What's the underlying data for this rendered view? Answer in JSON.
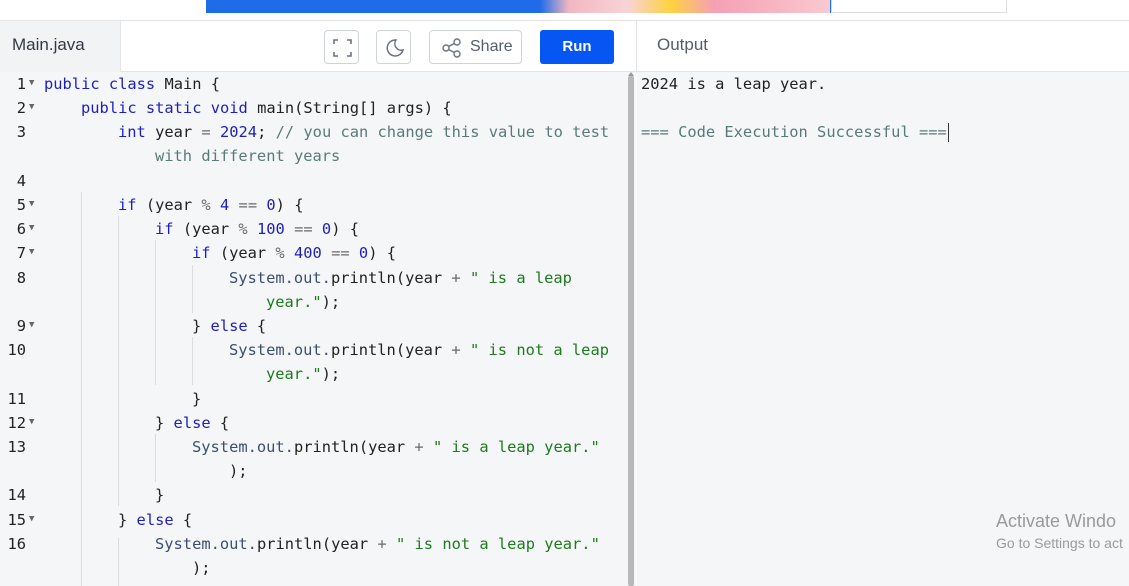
{
  "header": {
    "file_tab": "Main.java",
    "share_label": "Share",
    "run_label": "Run",
    "output_title": "Output"
  },
  "editor": {
    "line_numbers": [
      "1",
      "2",
      "3",
      "4",
      "5",
      "6",
      "7",
      "8",
      "9",
      "10",
      "11",
      "12",
      "13",
      "14",
      "15",
      "16"
    ],
    "code": {
      "l1a": "public class",
      "l1b": " Main {",
      "l2a": "public static void",
      "l2b": " main(String[] args) {",
      "l3a": "int",
      "l3b": " year ",
      "l3c": "=",
      "l3d": " ",
      "l3e": "2024",
      "l3f": "; ",
      "l3g": "// you can change this value to test",
      "l3h": "with different years",
      "l5a": "if",
      "l5b": " (year ",
      "l5c": "%",
      "l5d": " ",
      "l5e": "4",
      "l5f": " ",
      "l5g": "==",
      "l5h": " ",
      "l5i": "0",
      "l5j": ") {",
      "l6a": "if",
      "l6b": " (year ",
      "l6c": "%",
      "l6d": " ",
      "l6e": "100",
      "l6f": " ",
      "l6g": "==",
      "l6h": " ",
      "l6i": "0",
      "l6j": ") {",
      "l7a": "if",
      "l7b": " (year ",
      "l7c": "%",
      "l7d": " ",
      "l7e": "400",
      "l7f": " ",
      "l7g": "==",
      "l7h": " ",
      "l7i": "0",
      "l7j": ") {",
      "l8a": "System",
      "l8b": ".out.",
      "l8c": "println(year ",
      "l8d": "+",
      "l8e": " ",
      "l8f": "\" is a leap",
      "l8g": "year.\"",
      "l8h": ");",
      "l9a": "} ",
      "l9b": "else",
      "l9c": " {",
      "l10a": "System",
      "l10b": ".out.",
      "l10c": "println(year ",
      "l10d": "+",
      "l10e": " ",
      "l10f": "\" is not a leap",
      "l10g": "year.\"",
      "l10h": ");",
      "l11": "}",
      "l12a": "} ",
      "l12b": "else",
      "l12c": " {",
      "l13a": "System",
      "l13b": ".out.",
      "l13c": "println(year ",
      "l13d": "+",
      "l13e": " ",
      "l13f": "\" is a leap year.\"",
      "l13g": ");",
      "l14": "}",
      "l15a": "} ",
      "l15b": "else",
      "l15c": " {",
      "l16a": "System",
      "l16b": ".out.",
      "l16c": "println(year ",
      "l16d": "+",
      "l16e": " ",
      "l16f": "\" is not a leap year.\"",
      "l16g": ");"
    }
  },
  "output": {
    "line1": "2024 is a leap year.",
    "line2": "=== Code Execution Successful ==="
  },
  "watermark": {
    "title": "Activate Windo",
    "subtitle": "Go to Settings to act"
  },
  "colors": {
    "run_button": "#0556f3",
    "keyword": "#1d1fbf",
    "string": "#1e7a1e",
    "comment": "#5a7a7a"
  },
  "icons": [
    "fullscreen-icon",
    "dark-mode-icon",
    "share-icon",
    "fold-arrow-icon"
  ]
}
